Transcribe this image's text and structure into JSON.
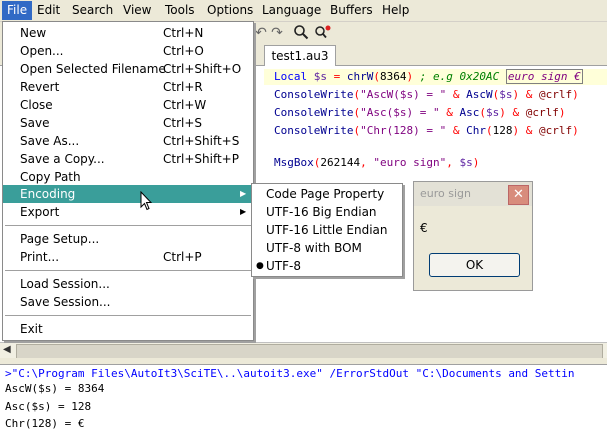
{
  "menubar": {
    "items": [
      "File",
      "Edit",
      "Search",
      "View",
      "Tools",
      "Options",
      "Language",
      "Buffers",
      "Help"
    ],
    "open_item": "File"
  },
  "toolbar": {
    "undo_icon": "undo-icon",
    "redo_icon": "redo-icon",
    "find_icon": "find-icon",
    "replace_icon": "replace-icon"
  },
  "tab": {
    "label": "test1.au3"
  },
  "code": {
    "line1": {
      "kw": "Local ",
      "var": "$s",
      "eq": " = ",
      "fn": "chrW",
      "open": "(",
      "num": "8364",
      "close": ")",
      "comment": " ; e.g 0x20AC ",
      "boxed": "euro sign €"
    },
    "line2": {
      "fn": "ConsoleWrite",
      "a": "(",
      "str": "\"AscW($s) = \"",
      "amp1": " & ",
      "fn2": "AscW",
      "p1": "(",
      "var": "$s",
      "p2": ")",
      "amp2": " & ",
      "mac": "@crlf",
      "close": ")"
    },
    "line3": {
      "fn": "ConsoleWrite",
      "a": "(",
      "str": "\"Asc($s) = \"",
      "amp1": " & ",
      "fn2": "Asc",
      "p1": "(",
      "var": "$s",
      "p2": ")",
      "amp2": " & ",
      "mac": "@crlf",
      "close": ")"
    },
    "line4": {
      "fn": "ConsoleWrite",
      "a": "(",
      "str": "\"Chr(128) = \"",
      "amp1": " & ",
      "fn2": "Chr",
      "p1": "(",
      "num": "128",
      "p2": ")",
      "amp2": " & ",
      "mac": "@crlf",
      "close": ")"
    },
    "line5": {
      "fn": "MsgBox",
      "a": "(",
      "num": "262144",
      "c1": ", ",
      "str": "\"euro sign\"",
      "c2": ", ",
      "var": "$s",
      "close": ")"
    }
  },
  "file_menu": {
    "items": [
      {
        "label": "New",
        "shortcut": "Ctrl+N"
      },
      {
        "label": "Open...",
        "shortcut": "Ctrl+O"
      },
      {
        "label": "Open Selected Filename",
        "shortcut": "Ctrl+Shift+O"
      },
      {
        "label": "Revert",
        "shortcut": "Ctrl+R"
      },
      {
        "label": "Close",
        "shortcut": "Ctrl+W"
      },
      {
        "label": "Save",
        "shortcut": "Ctrl+S"
      },
      {
        "label": "Save As...",
        "shortcut": "Ctrl+Shift+S"
      },
      {
        "label": "Save a Copy...",
        "shortcut": "Ctrl+Shift+P"
      },
      {
        "label": "Copy Path",
        "shortcut": ""
      },
      {
        "label": "Encoding",
        "shortcut": ""
      },
      {
        "label": "Export",
        "shortcut": ""
      },
      {
        "label": "Page Setup...",
        "shortcut": ""
      },
      {
        "label": "Print...",
        "shortcut": "Ctrl+P"
      },
      {
        "label": "Load Session...",
        "shortcut": ""
      },
      {
        "label": "Save Session...",
        "shortcut": ""
      },
      {
        "label": "Exit",
        "shortcut": ""
      }
    ],
    "highlighted": "Encoding"
  },
  "encoding_submenu": {
    "items": [
      "Code Page Property",
      "UTF-16 Big Endian",
      "UTF-16 Little Endian",
      "UTF-8 with BOM",
      "UTF-8"
    ],
    "selected": "UTF-8"
  },
  "dialog": {
    "title": "euro sign",
    "message": "€",
    "ok_label": "OK"
  },
  "output": {
    "lines": [
      ">\"C:\\Program Files\\AutoIt3\\SciTE\\..\\autoit3.exe\" /ErrorStdOut \"C:\\Documents and Settin",
      "AscW($s) = 8364",
      "Asc($s) = 128",
      "Chr(128) = €"
    ]
  }
}
